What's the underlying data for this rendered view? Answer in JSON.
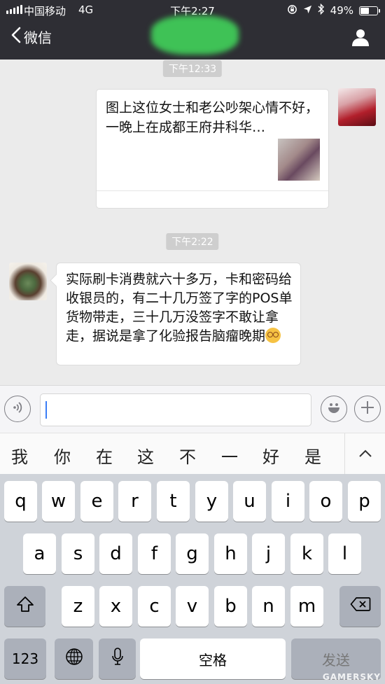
{
  "status_bar": {
    "carrier": "中国移动",
    "network": "4G",
    "time": "下午2:27",
    "battery_percent": "49%",
    "battery_level": 0.49
  },
  "navbar": {
    "back_label": "微信"
  },
  "chat": {
    "timestamp_1": "下午12:33",
    "link_title": "图上这位女士和老公吵架心情不好，一晚上在成都王府井科华…",
    "timestamp_2": "下午2:22",
    "message_text": "实际刷卡消费就六十多万，卡和密码给收银员的，有二十几万签了字的POS单货物带走，三十几万没签字不敢让拿走，据说是拿了化验报告脑瘤晚期"
  },
  "input_bar": {
    "value": ""
  },
  "candidates": [
    "我",
    "你",
    "在",
    "这",
    "不",
    "一",
    "好",
    "是"
  ],
  "keyboard": {
    "row1": [
      "q",
      "w",
      "e",
      "r",
      "t",
      "y",
      "u",
      "i",
      "o",
      "p"
    ],
    "row2": [
      "a",
      "s",
      "d",
      "f",
      "g",
      "h",
      "j",
      "k",
      "l"
    ],
    "row3": [
      "z",
      "x",
      "c",
      "v",
      "b",
      "n",
      "m"
    ],
    "numbers_label": "123",
    "space_label": "空格",
    "send_label": "发送"
  },
  "watermark": "GAMERSKY",
  "colors": {
    "header_bg": "#2e2e34",
    "chat_bg": "#ebebeb",
    "keyboard_bg": "#cfd3d9",
    "caret": "#3a7df6"
  }
}
